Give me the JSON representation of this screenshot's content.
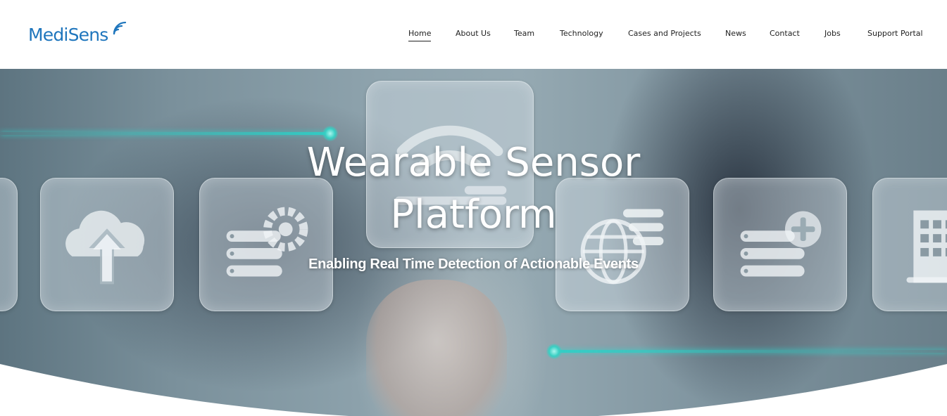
{
  "brand": {
    "name_part1": "Medi",
    "name_part2": "Sens",
    "color": "#1f76bd"
  },
  "nav": {
    "items": [
      {
        "label": "Home",
        "active": true
      },
      {
        "label": "About Us",
        "active": false
      },
      {
        "label": "Team",
        "active": false
      },
      {
        "label": "Technology",
        "active": false
      },
      {
        "label": "Cases and Projects",
        "active": false
      },
      {
        "label": "News",
        "active": false
      },
      {
        "label": "Contact",
        "active": false
      },
      {
        "label": "Jobs",
        "active": false
      },
      {
        "label": "Support Portal",
        "active": false
      }
    ]
  },
  "hero": {
    "title_line1": "Wearable Sensor",
    "title_line2": "Platform",
    "subtitle": "Enabling Real Time Detection of Actionable Events",
    "accent_color": "#37cfc3",
    "tile_icons": [
      "cloud-upload-icon",
      "server-settings-icon",
      "wifi-icon",
      "globe-list-icon",
      "server-add-icon",
      "building-icon"
    ]
  }
}
